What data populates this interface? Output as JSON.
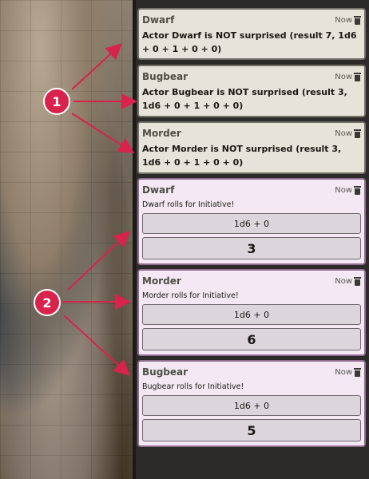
{
  "colors": {
    "annotation": "#d8234c",
    "surprise_card_bg": "#e6e4da",
    "roll_card_bg": "#f3e8f3"
  },
  "annotations": [
    {
      "label": "1"
    },
    {
      "label": "2"
    }
  ],
  "messages": [
    {
      "speaker": "Dwarf",
      "time": "Now",
      "content": "Actor Dwarf is NOT surprised (result 7, 1d6 + 0 + 1 + 0 + 0)"
    },
    {
      "speaker": "Bugbear",
      "time": "Now",
      "content": "Actor Bugbear is NOT surprised (result 3, 1d6 + 0 + 1 + 0 + 0)"
    },
    {
      "speaker": "Morder",
      "time": "Now",
      "content": "Actor Morder is NOT surprised (result 3, 1d6 + 0 + 1 + 0 + 0)"
    },
    {
      "speaker": "Dwarf",
      "time": "Now",
      "flavor": "Dwarf rolls for Initiative!",
      "formula": "1d6 + 0",
      "total": "3"
    },
    {
      "speaker": "Morder",
      "time": "Now",
      "flavor": "Morder rolls for Initiative!",
      "formula": "1d6 + 0",
      "total": "6"
    },
    {
      "speaker": "Bugbear",
      "time": "Now",
      "flavor": "Bugbear rolls for Initiative!",
      "formula": "1d6 + 0",
      "total": "5"
    }
  ],
  "icons": {
    "delete": "trash-icon"
  }
}
